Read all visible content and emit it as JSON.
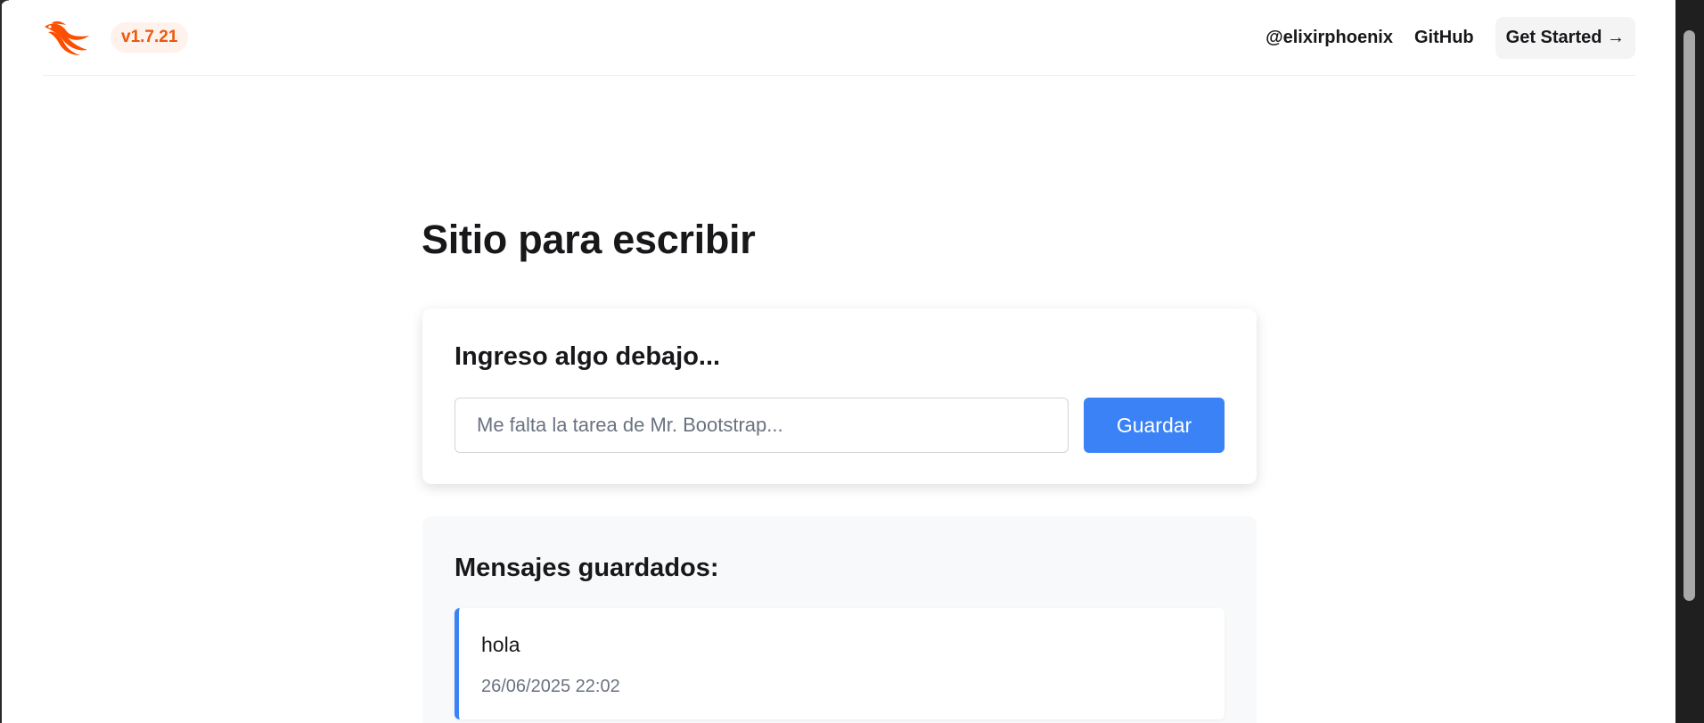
{
  "header": {
    "version": "v1.7.21",
    "nav": {
      "twitter": "@elixirphoenix",
      "github": "GitHub",
      "get_started": "Get Started →"
    },
    "brand_color": "#fd4f00"
  },
  "main": {
    "title": "Sitio para escribir",
    "form": {
      "heading": "Ingreso algo debajo...",
      "placeholder": "Me falta la tarea de Mr. Bootstrap...",
      "value": "",
      "button": "Guardar"
    },
    "messages": {
      "heading": "Mensajes guardados:",
      "items": [
        {
          "text": "hola",
          "timestamp": "26/06/2025 22:02"
        }
      ]
    }
  },
  "colors": {
    "accent": "#3b82f6",
    "version_text": "#ea580c",
    "version_bg": "#fff1ec"
  },
  "icons": {
    "logo": "phoenix-logo-icon"
  }
}
